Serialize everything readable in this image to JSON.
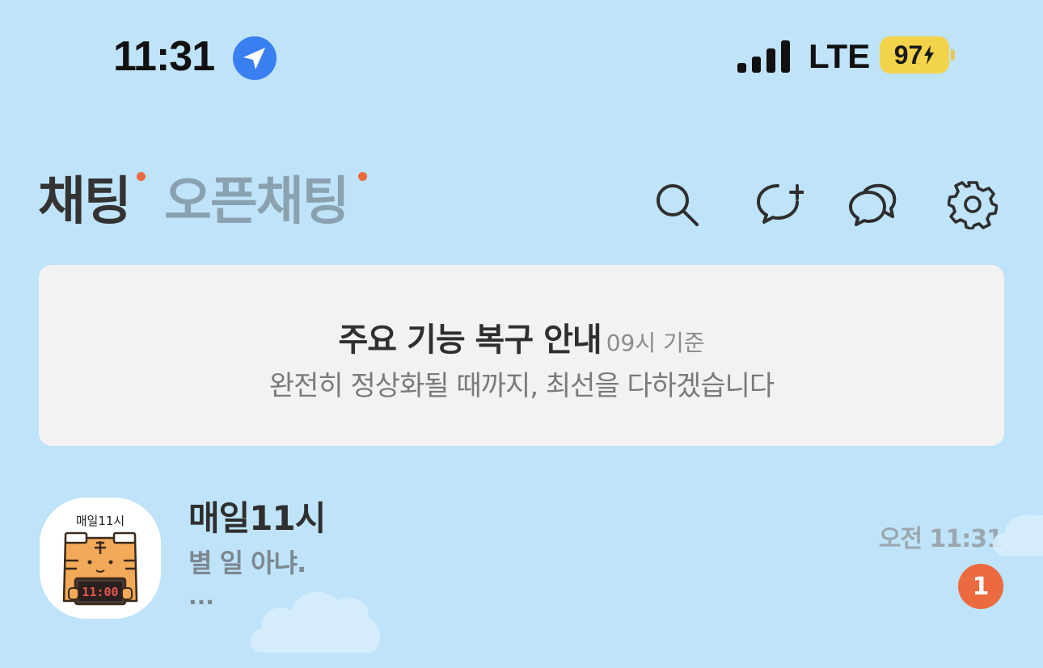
{
  "status_bar": {
    "time": "11:31",
    "network": "LTE",
    "battery": "97",
    "location_icon": "location-arrow-icon",
    "signal_icon": "cellular-signal-icon",
    "charging_icon": "lightning-bolt-icon"
  },
  "header": {
    "tabs": [
      {
        "label": "채팅",
        "active": true,
        "has_new_dot": true
      },
      {
        "label": "오픈채팅",
        "active": false,
        "has_new_dot": true
      }
    ],
    "icons": [
      "search-icon",
      "new-chat-icon",
      "open-chat-icon",
      "settings-icon"
    ]
  },
  "notice": {
    "title": "주요 기능 복구 안내",
    "time_note": "09시 기준",
    "message": "완전히 정상화될 때까지, 최선을 다하겠습니다"
  },
  "chats": [
    {
      "name": "매일11시",
      "preview": "별 일 아냐.",
      "preview_more": "...",
      "time": "오전 11:31",
      "unread": "1",
      "avatar": {
        "label": "매일11시",
        "clock": "11:00"
      }
    }
  ],
  "colors": {
    "background": "#bfe3f8",
    "accent_dot": "#ec6a3f",
    "battery": "#f2d34a",
    "location_blue": "#3a7ff0",
    "notice_bg": "#f2f2f2"
  }
}
